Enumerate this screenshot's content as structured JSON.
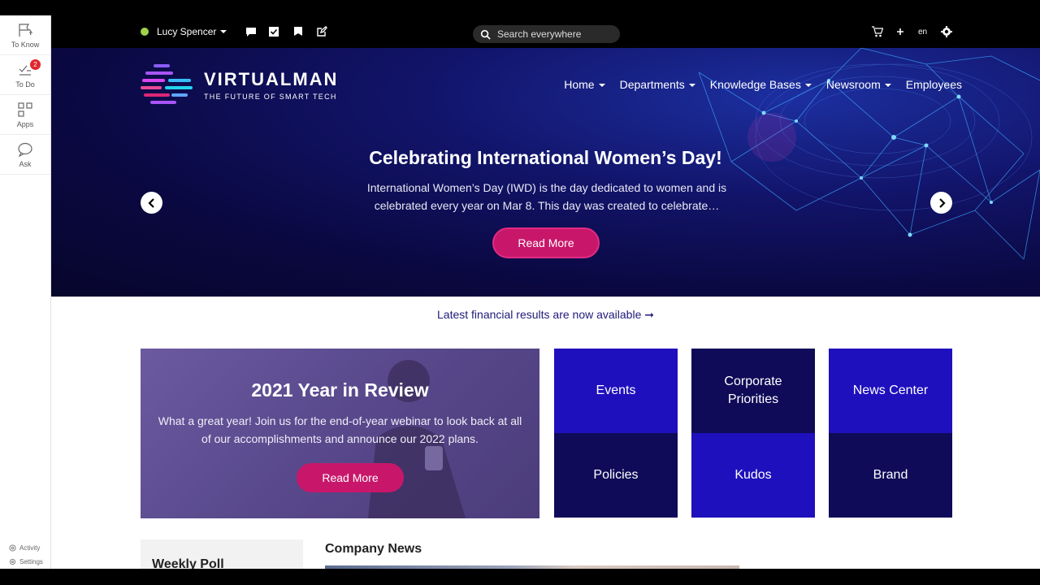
{
  "rail": {
    "items": [
      {
        "label": "To Know",
        "icon": "flag-icon"
      },
      {
        "label": "To Do",
        "icon": "checklist-icon",
        "badge": "2"
      },
      {
        "label": "Apps",
        "icon": "apps-grid-icon"
      },
      {
        "label": "Ask",
        "icon": "chat-bubble-icon"
      }
    ],
    "bottom": [
      {
        "label": "Activity",
        "icon": "activity-icon"
      },
      {
        "label": "Settings",
        "icon": "settings-icon"
      }
    ]
  },
  "topbar": {
    "user_name": "Lucy Spencer",
    "status_color": "#9fd24a",
    "icons": [
      "message-icon",
      "checkbox-icon",
      "flag-icon",
      "edit-icon",
      "cart-icon",
      "plus-icon",
      "gear-icon"
    ],
    "search_placeholder": "Search everywhere",
    "language": "en"
  },
  "brand": {
    "name": "VIRTUALMAN",
    "tagline": "THE FUTURE OF SMART TECH"
  },
  "nav": {
    "items": [
      {
        "label": "Home",
        "dropdown": true
      },
      {
        "label": "Departments",
        "dropdown": true
      },
      {
        "label": "Knowledge Bases",
        "dropdown": true
      },
      {
        "label": "Newsroom",
        "dropdown": true
      },
      {
        "label": "Employees",
        "dropdown": false
      }
    ]
  },
  "hero": {
    "title": "Celebrating International Women’s Day!",
    "text": "International Women’s Day (IWD) is the day dedicated to women and is celebrated every year on Mar 8. This day was created to celebrate…",
    "button": "Read More",
    "accent": "#c8176b"
  },
  "announcement": "Latest financial results are now available ➞",
  "promo": {
    "title": "2021 Year in Review",
    "text": "What a great year! Join us for the end-of-year webinar to look back at all of our accomplishments and announce our 2022 plans.",
    "button": "Read More"
  },
  "tiles": [
    {
      "label": "Events",
      "tone": "bright"
    },
    {
      "label": "Corporate Priorities",
      "tone": "dark"
    },
    {
      "label": "News Center",
      "tone": "bright"
    },
    {
      "label": "Policies",
      "tone": "dark"
    },
    {
      "label": "Kudos",
      "tone": "bright"
    },
    {
      "label": "Brand",
      "tone": "dark"
    }
  ],
  "weekly_poll_title": "Weekly Poll",
  "company_news_title": "Company News"
}
